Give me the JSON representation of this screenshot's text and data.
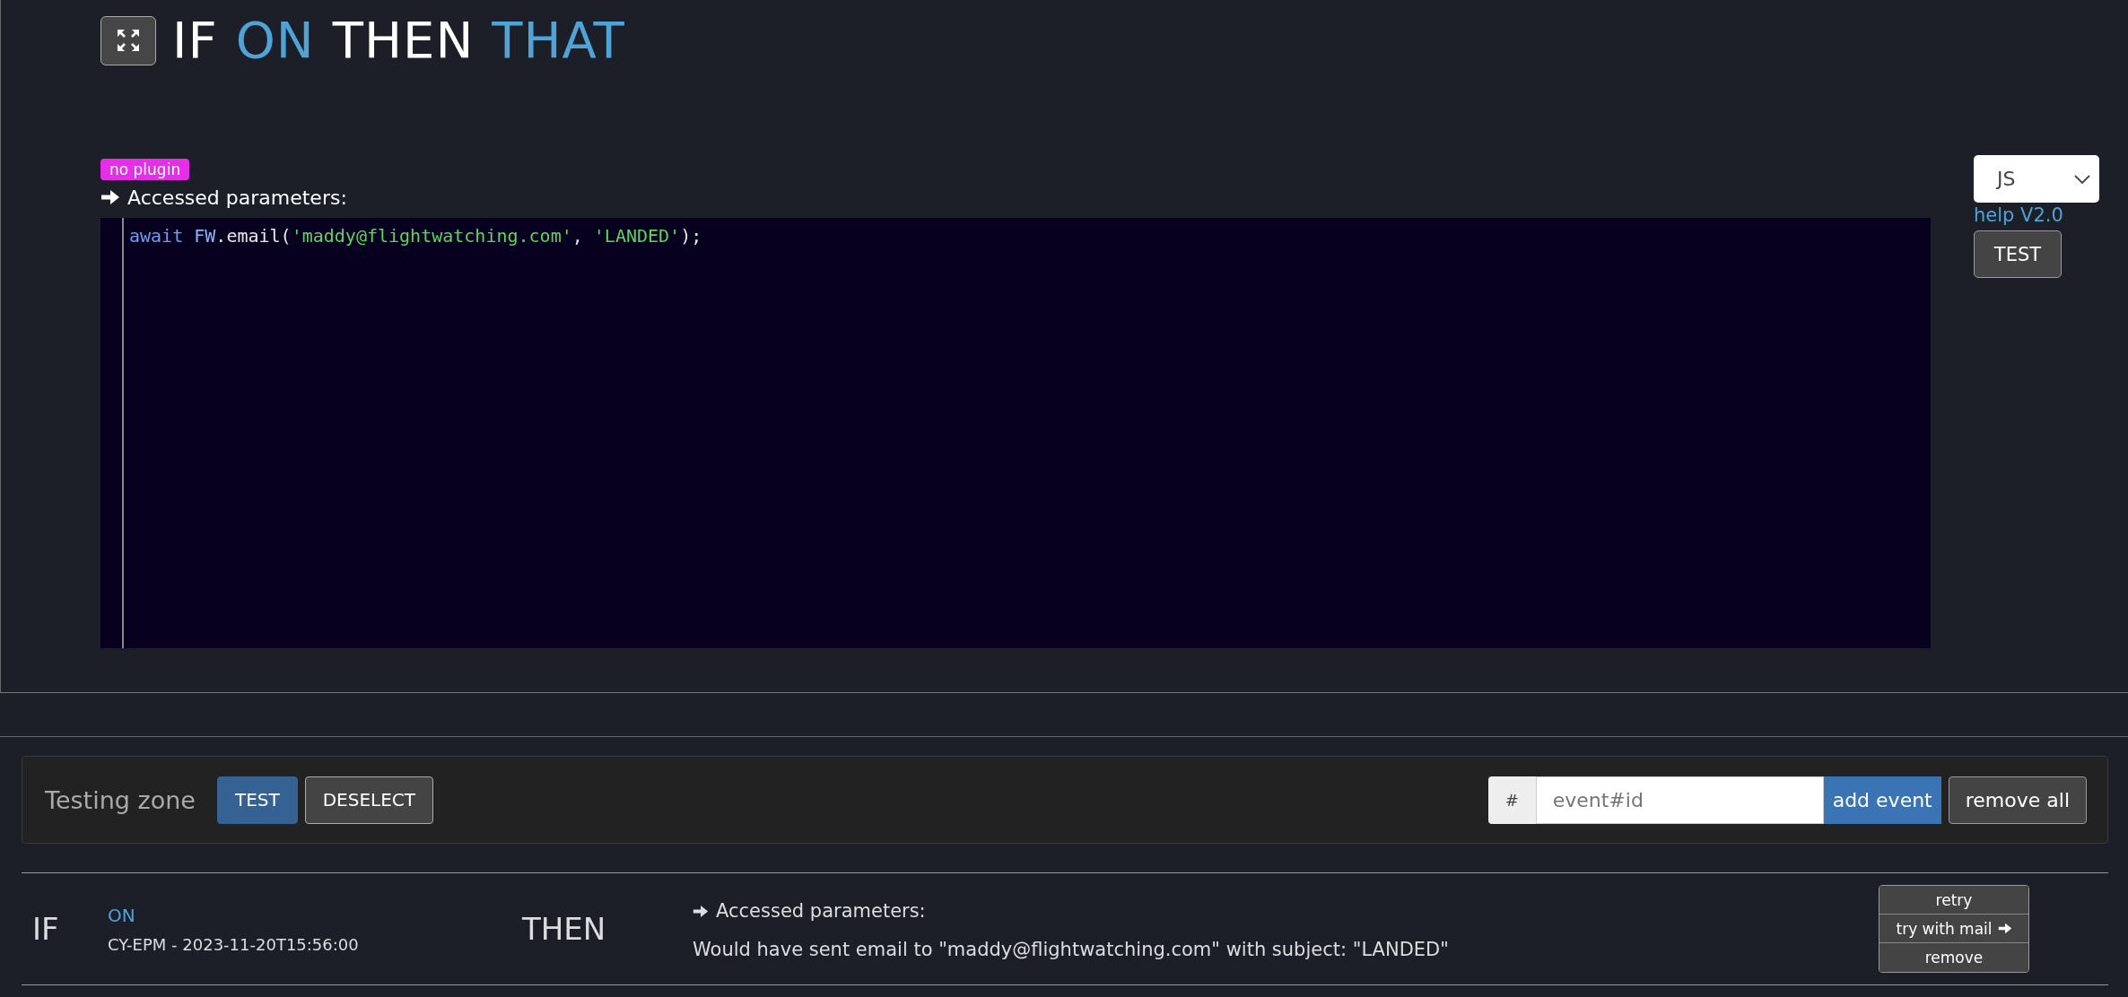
{
  "header": {
    "title": [
      {
        "text": "IF",
        "accent": false
      },
      {
        "text": "ON",
        "accent": true
      },
      {
        "text": "THEN",
        "accent": false
      },
      {
        "text": "THAT",
        "accent": true
      }
    ]
  },
  "editor": {
    "badge": "no plugin",
    "label": "Accessed parameters:",
    "code": [
      {
        "text": "await ",
        "kind": "keyword"
      },
      {
        "text": "FW",
        "kind": "variable"
      },
      {
        "text": ".email(",
        "kind": "plain"
      },
      {
        "text": "'maddy@flightwatching.com'",
        "kind": "string"
      },
      {
        "text": ", ",
        "kind": "plain"
      },
      {
        "text": "'LANDED'",
        "kind": "string"
      },
      {
        "text": ");",
        "kind": "plain"
      }
    ]
  },
  "side_controls": {
    "language": "JS",
    "help_link": "help V2.0",
    "test_button": "TEST"
  },
  "testing_zone": {
    "title": "Testing zone",
    "buttons": [
      {
        "label": "TEST",
        "kind": "primary"
      },
      {
        "label": "DESELECT",
        "kind": "default"
      }
    ],
    "event_prefix": "#",
    "event_placeholder": "event#id",
    "add_button": "add event",
    "remove_all_button": "remove all"
  },
  "events": [
    {
      "if_label": "IF",
      "trigger": "ON",
      "detail": "CY-EPM - 2023-11-20T15:56:00",
      "then_label": "THEN",
      "params_label": "Accessed parameters:",
      "result": "Would have sent email to \"maddy@flightwatching.com\" with subject: \"LANDED\"",
      "actions": [
        {
          "label": "retry",
          "arrow": false
        },
        {
          "label": "try with mail",
          "arrow": true
        },
        {
          "label": "remove",
          "arrow": false
        }
      ]
    }
  ]
}
